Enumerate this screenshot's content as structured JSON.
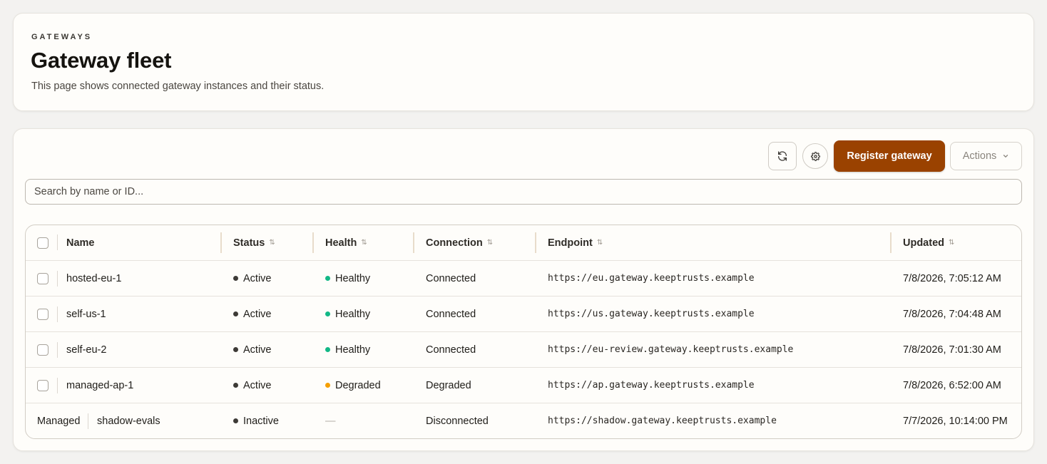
{
  "header": {
    "eyebrow": "GATEWAYS",
    "title": "Gateway fleet",
    "description": "This page shows connected gateway instances and their status."
  },
  "toolbar": {
    "refresh_icon": "refresh-icon",
    "settings_icon": "gear-icon",
    "primary_label": "Register gateway",
    "primary_color": "#9a4200",
    "actions_label": "Actions"
  },
  "search": {
    "placeholder": "Search by name or ID..."
  },
  "table": {
    "columns": {
      "name": "Name",
      "status": "Status",
      "health": "Health",
      "connection": "Connection",
      "endpoint": "Endpoint",
      "updated": "Updated"
    },
    "rows": [
      {
        "name": "hosted-eu-1",
        "status": "Active",
        "health": "Healthy",
        "connection": "Connected",
        "endpoint": "https://eu.gateway.keeptrusts.example",
        "updated": "7/8/2026, 7:05:12 AM"
      },
      {
        "name": "self-us-1",
        "status": "Active",
        "health": "Healthy",
        "connection": "Connected",
        "endpoint": "https://us.gateway.keeptrusts.example",
        "updated": "7/8/2026, 7:04:48 AM"
      },
      {
        "name": "self-eu-2",
        "status": "Active",
        "health": "Healthy",
        "connection": "Connected",
        "endpoint": "https://eu-review.gateway.keeptrusts.example",
        "updated": "7/8/2026, 7:01:30 AM"
      },
      {
        "name": "managed-ap-1",
        "status": "Active",
        "health": "Degraded",
        "connection": "Degraded",
        "endpoint": "https://ap.gateway.keeptrusts.example",
        "updated": "7/8/2026, 6:52:00 AM"
      },
      {
        "managed_label": "Managed",
        "name": "shadow-evals",
        "status": "Inactive",
        "health": "—",
        "connection": "Disconnected",
        "endpoint": "https://shadow.gateway.keeptrusts.example",
        "updated": "7/7/2026, 10:14:00 PM"
      }
    ]
  },
  "colors": {
    "status_dot": "#3d3a36",
    "healthy": "#12b886",
    "degraded": "#f59f00"
  }
}
